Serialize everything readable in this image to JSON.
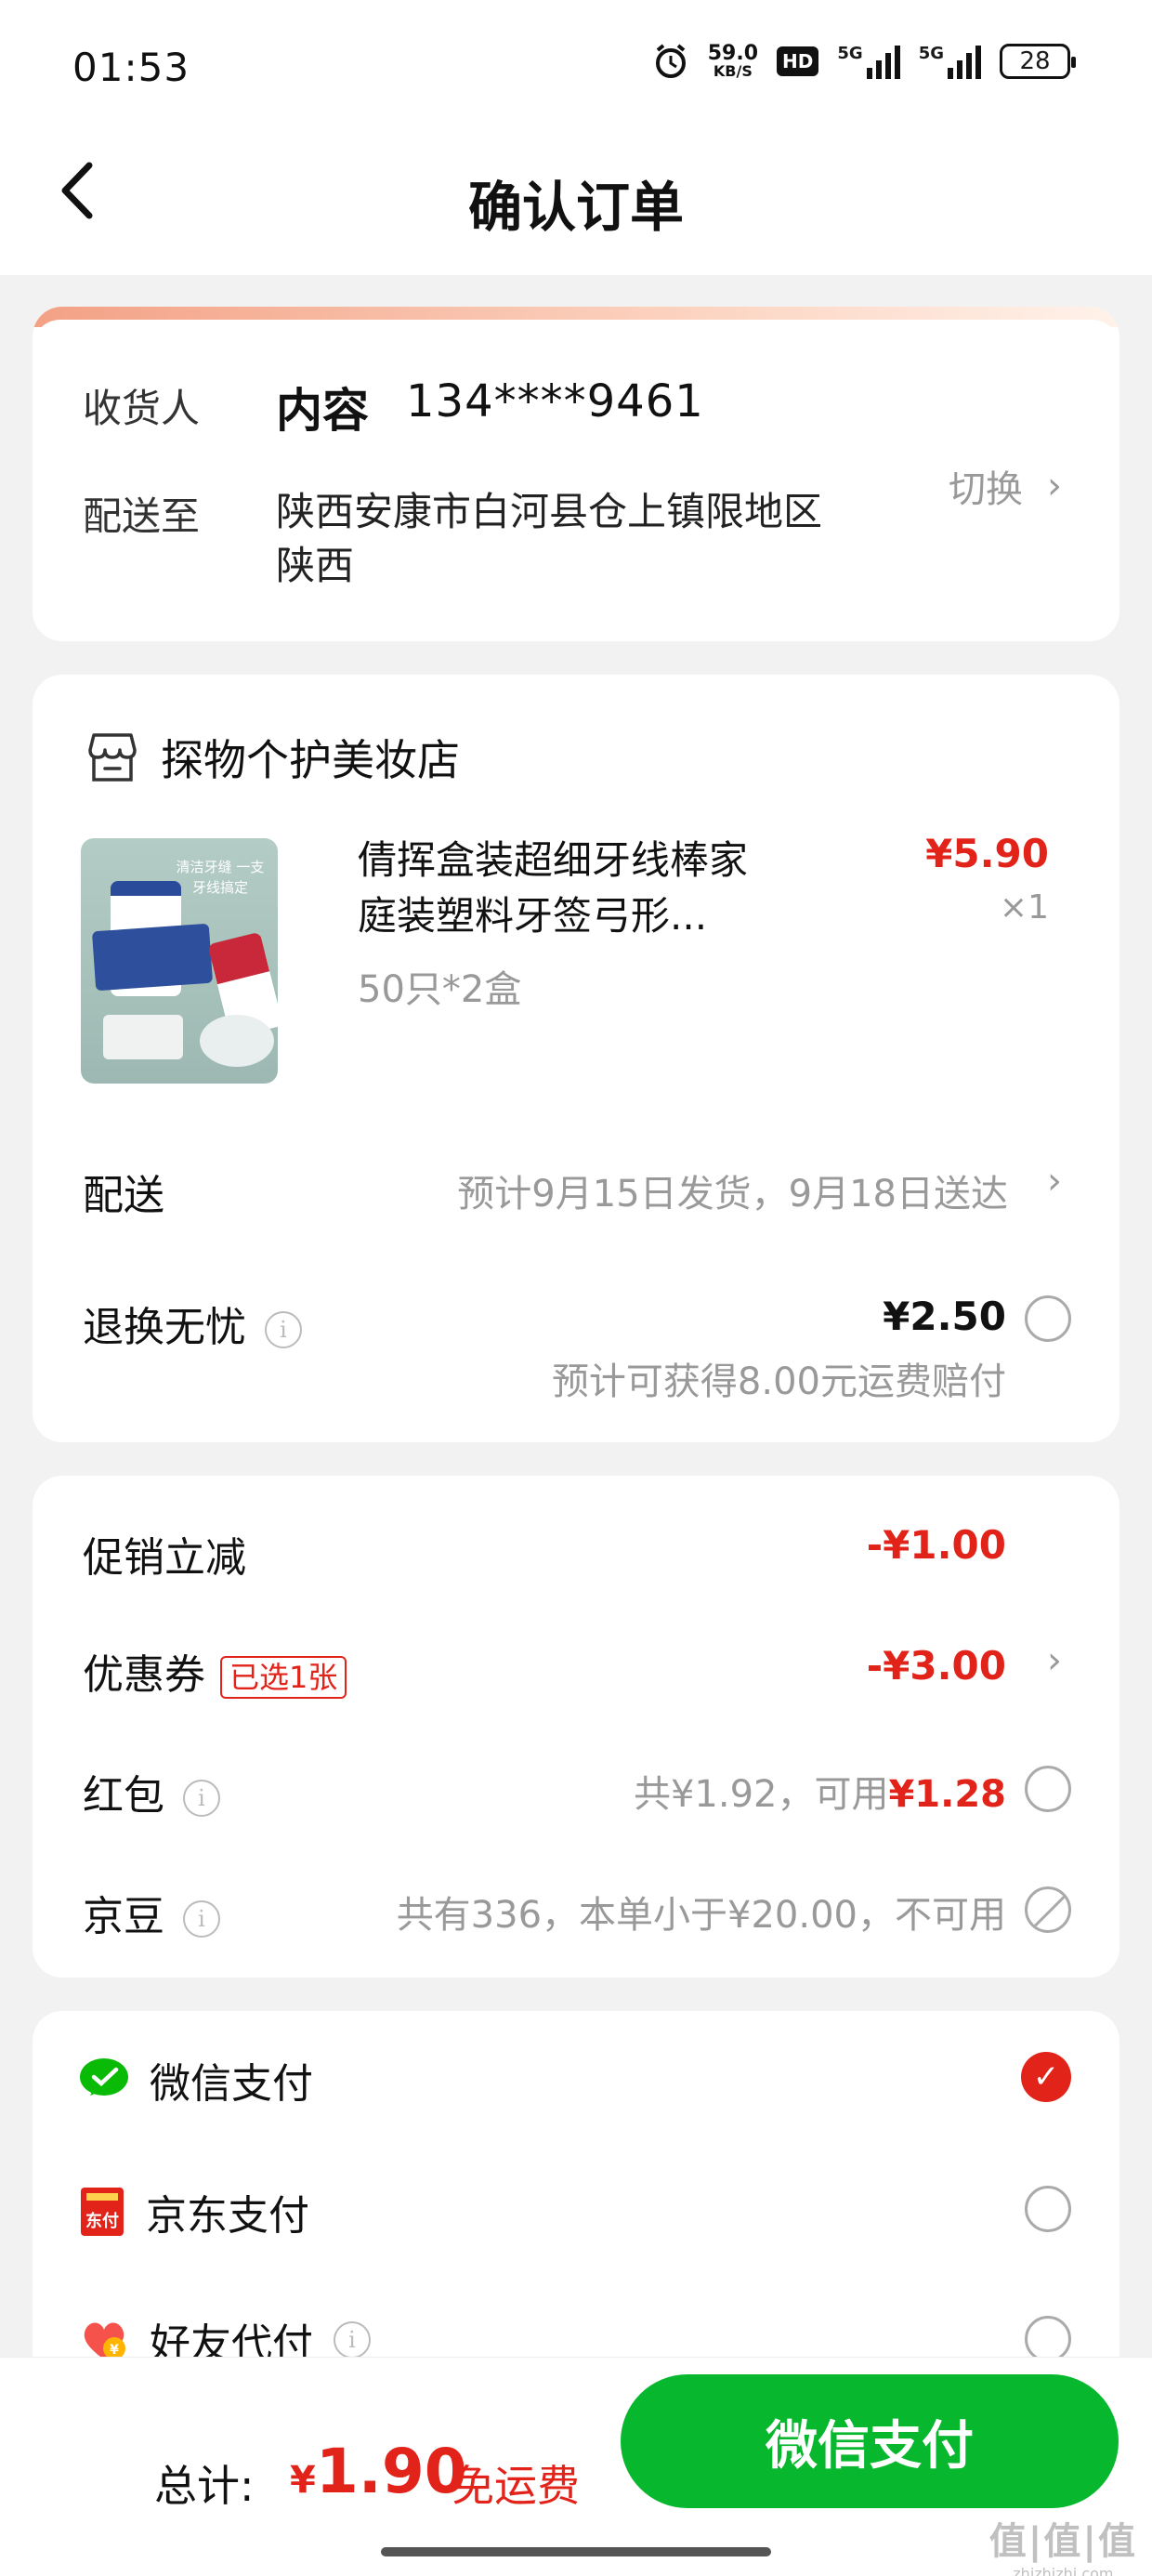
{
  "status_bar": {
    "time": "01:53",
    "net_speed": "59.0",
    "net_unit": "KB/S",
    "hd": "HD",
    "sig1": "5G",
    "sig2": "5G",
    "battery": "28"
  },
  "header": {
    "title": "确认订单"
  },
  "address": {
    "receiver_label": "收货人",
    "name": "内容",
    "phone": "134****9461",
    "ship_to_label": "配送至",
    "address": "陕西安康市白河县仓上镇限地区 陕西",
    "switch_label": "切换"
  },
  "store": {
    "name": "探物个护美妆店",
    "product": {
      "title": "倩挥盒装超细牙线棒家庭装塑料牙签弓形...",
      "spec": "50只*2盒",
      "price": "¥5.90",
      "qty": "×1",
      "image_text": "清洁牙缝 一支牙线搞定"
    },
    "delivery_label": "配送",
    "delivery_text": "预计9月15日发货，9月18日送达",
    "worry_label": "退换无忧",
    "worry_price": "¥2.50",
    "worry_sub": "预计可获得8.00元运费赔付"
  },
  "discounts": {
    "promo_label": "促销立减",
    "promo_value": "-¥1.00",
    "coupon_label": "优惠券",
    "coupon_tag": "已选1张",
    "coupon_value": "-¥3.00",
    "redpack_label": "红包",
    "redpack_prefix": "共¥1.92，可用",
    "redpack_value": "¥1.28",
    "jd_label": "京豆",
    "jd_text": "共有336，本单小于¥20.00，不可用"
  },
  "payment": {
    "wechat": "微信支付",
    "jd": "京东支付",
    "friend": "好友代付"
  },
  "bottom": {
    "total_label": "总计:",
    "currency": "¥",
    "total": "1.90",
    "free_shipping": "免运费",
    "pay_button": "微信支付"
  },
  "watermark": {
    "big": "值|值|值",
    "small": "zhizhizhi.com"
  },
  "colors": {
    "accent_red": "#e2231a",
    "pay_green": "#07b82e"
  }
}
